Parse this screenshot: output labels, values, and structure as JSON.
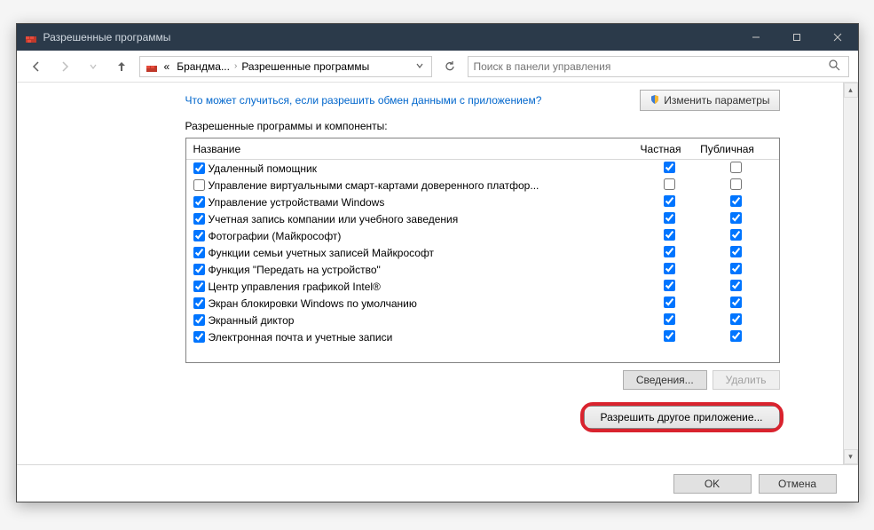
{
  "window": {
    "title": "Разрешенные программы"
  },
  "nav": {
    "breadcrumb": {
      "prefix": "«",
      "item1": "Брандма...",
      "item2": "Разрешенные программы"
    },
    "search_placeholder": "Поиск в панели управления"
  },
  "top": {
    "help_link": "Что может случиться, если разрешить обмен данными с приложением?",
    "change_params": "Изменить параметры"
  },
  "group_label": "Разрешенные программы и компоненты:",
  "columns": {
    "name": "Название",
    "private": "Частная",
    "public": "Публичная"
  },
  "rows": [
    {
      "enabled": true,
      "name": "Удаленный помощник",
      "private": true,
      "public": false
    },
    {
      "enabled": false,
      "name": "Управление виртуальными смарт-картами доверенного платфор...",
      "private": false,
      "public": false
    },
    {
      "enabled": true,
      "name": "Управление устройствами Windows",
      "private": true,
      "public": true
    },
    {
      "enabled": true,
      "name": "Учетная запись компании или учебного заведения",
      "private": true,
      "public": true
    },
    {
      "enabled": true,
      "name": "Фотографии (Майкрософт)",
      "private": true,
      "public": true
    },
    {
      "enabled": true,
      "name": "Функции семьи учетных записей Майкрософт",
      "private": true,
      "public": true
    },
    {
      "enabled": true,
      "name": "Функция \"Передать на устройство\"",
      "private": true,
      "public": true
    },
    {
      "enabled": true,
      "name": "Центр управления графикой Intel®",
      "private": true,
      "public": true
    },
    {
      "enabled": true,
      "name": "Экран блокировки Windows по умолчанию",
      "private": true,
      "public": true
    },
    {
      "enabled": true,
      "name": "Экранный диктор",
      "private": true,
      "public": true
    },
    {
      "enabled": true,
      "name": "Электронная почта и учетные записи",
      "private": true,
      "public": true
    }
  ],
  "buttons": {
    "details": "Сведения...",
    "delete": "Удалить",
    "allow_another": "Разрешить другое приложение...",
    "ok": "OK",
    "cancel": "Отмена"
  }
}
